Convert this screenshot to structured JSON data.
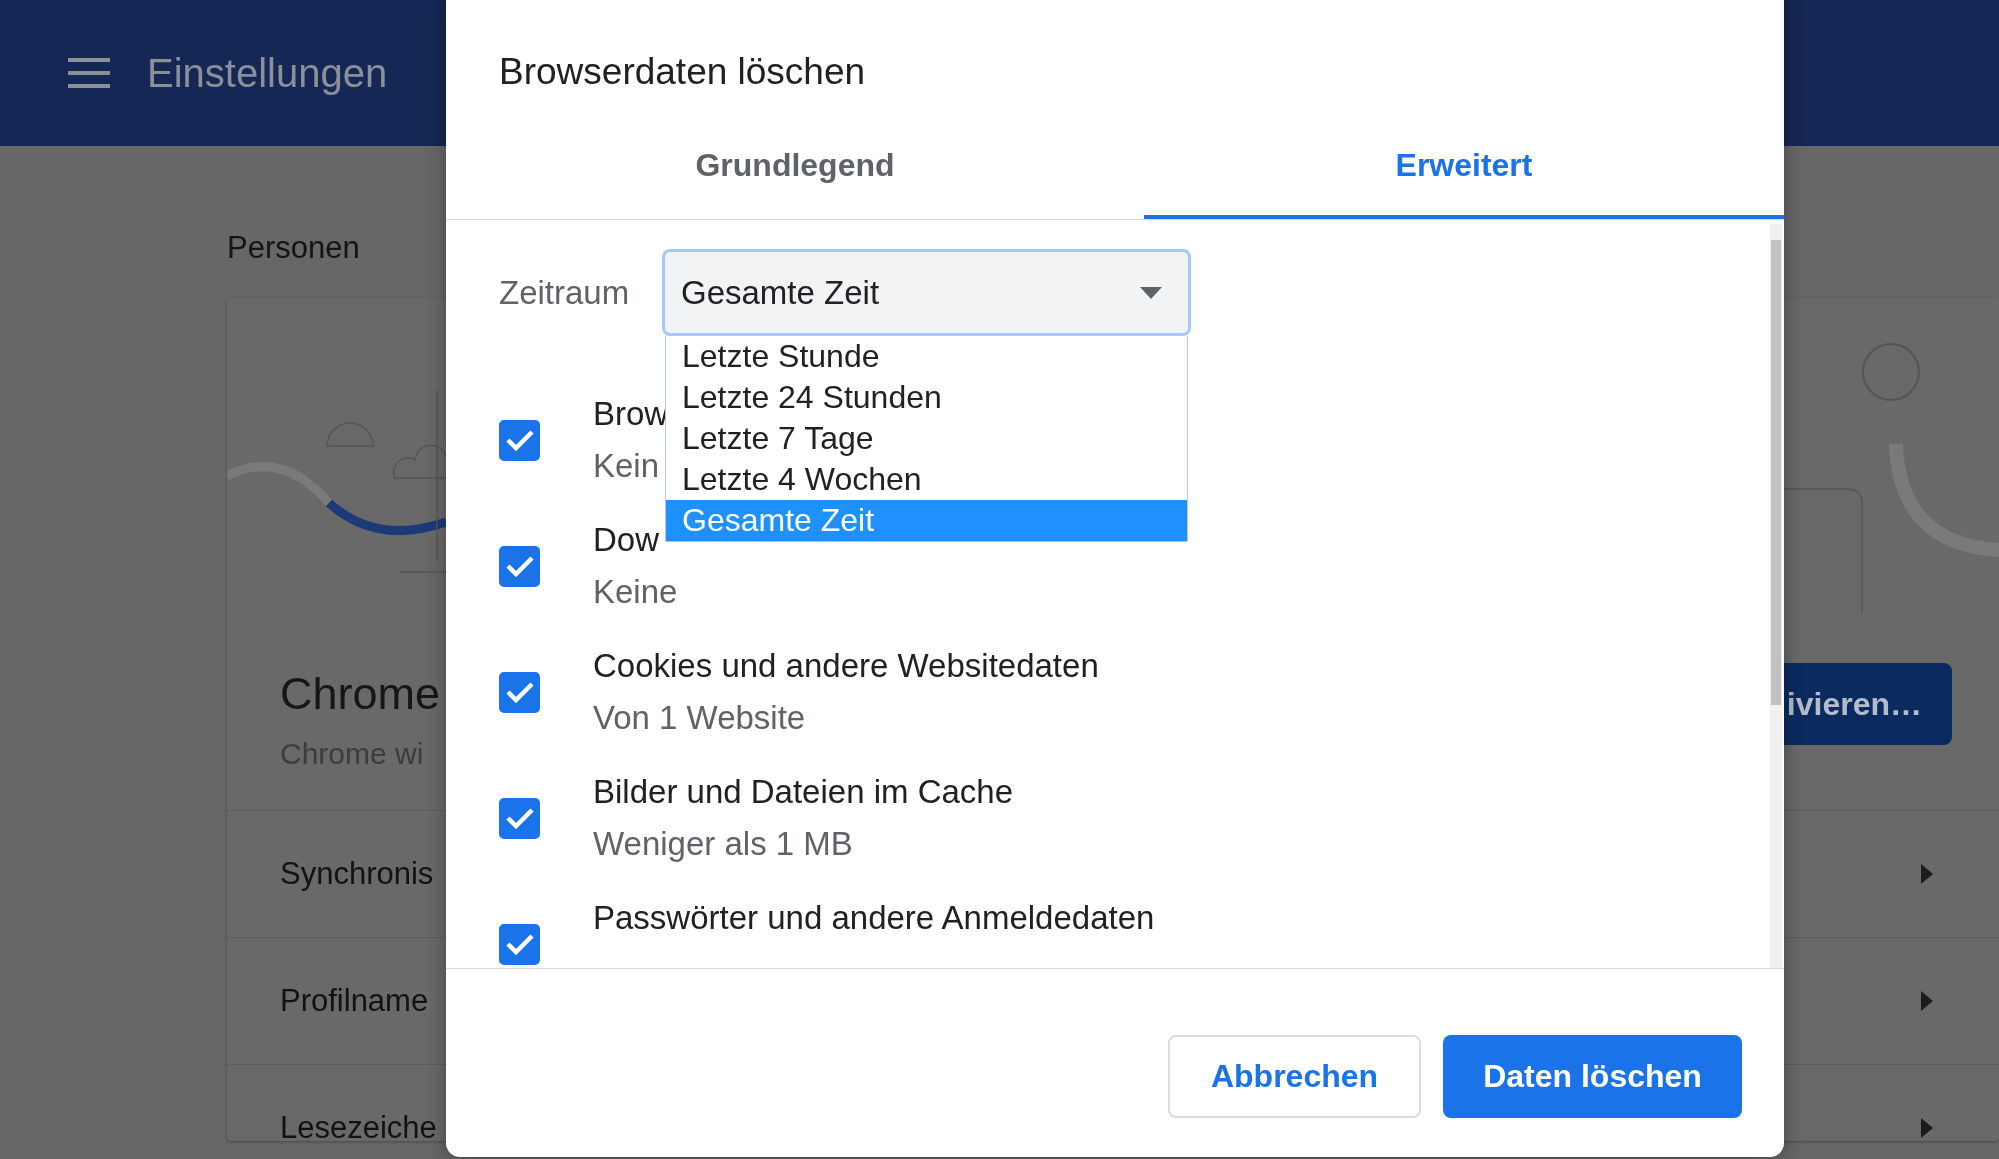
{
  "header": {
    "title": "Einstellungen"
  },
  "section_title": "Personen",
  "card": {
    "title": "Chrome",
    "subtitle": "Chrome wi",
    "button": "ivieren…",
    "rows": [
      {
        "label": "Synchronis"
      },
      {
        "label": "Profilname"
      },
      {
        "label": "Lesezeiche"
      }
    ]
  },
  "dialog": {
    "title": "Browserdaten löschen",
    "tabs": [
      {
        "label": "Grundlegend",
        "selected": false
      },
      {
        "label": "Erweitert",
        "selected": true
      }
    ],
    "time_range": {
      "label": "Zeitraum",
      "value": "Gesamte Zeit",
      "expanded": true,
      "options": [
        {
          "label": "Letzte Stunde",
          "selected": false
        },
        {
          "label": "Letzte 24 Stunden",
          "selected": false
        },
        {
          "label": "Letzte 7 Tage",
          "selected": false
        },
        {
          "label": "Letzte 4 Wochen",
          "selected": false
        },
        {
          "label": "Gesamte Zeit",
          "selected": true
        }
      ]
    },
    "items": [
      {
        "title": "Brow",
        "detail": "Kein",
        "checked": true
      },
      {
        "title": "Dow",
        "detail": "Keine",
        "checked": true
      },
      {
        "title": "Cookies und andere Websitedaten",
        "detail": "Von 1 Website",
        "checked": true
      },
      {
        "title": "Bilder und Dateien im Cache",
        "detail": "Weniger als 1 MB",
        "checked": true
      },
      {
        "title": "Passwörter und andere Anmeldedaten",
        "checked": true
      }
    ],
    "buttons": [
      {
        "label": "Abbrechen",
        "kind": "secondary"
      },
      {
        "label": "Daten löschen",
        "kind": "primary"
      }
    ]
  }
}
